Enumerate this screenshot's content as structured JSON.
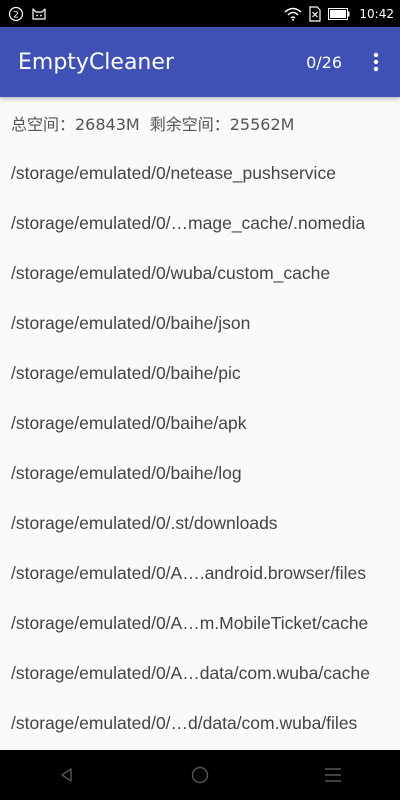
{
  "status_bar": {
    "notification_badge": "2",
    "time": "10:42",
    "icons": [
      "notification-count-icon",
      "cat-icon",
      "wifi-icon",
      "sim-icon",
      "battery-icon"
    ]
  },
  "app_bar": {
    "title": "EmptyCleaner",
    "counter": "0/26",
    "color": "#3f51b5"
  },
  "space_info": {
    "total": "总空间：26843M",
    "free": "剩余空间：25562M"
  },
  "items": [
    "/storage/emulated/0/netease_pushservice",
    "/storage/emulated/0/…mage_cache/.nomedia",
    "/storage/emulated/0/wuba/custom_cache",
    "/storage/emulated/0/baihe/json",
    "/storage/emulated/0/baihe/pic",
    "/storage/emulated/0/baihe/apk",
    "/storage/emulated/0/baihe/log",
    "/storage/emulated/0/.st/downloads",
    "/storage/emulated/0/A….android.browser/files",
    "/storage/emulated/0/A…m.MobileTicket/cache",
    "/storage/emulated/0/A…data/com.wuba/cache",
    "/storage/emulated/0/…d/data/com.wuba/files"
  ]
}
